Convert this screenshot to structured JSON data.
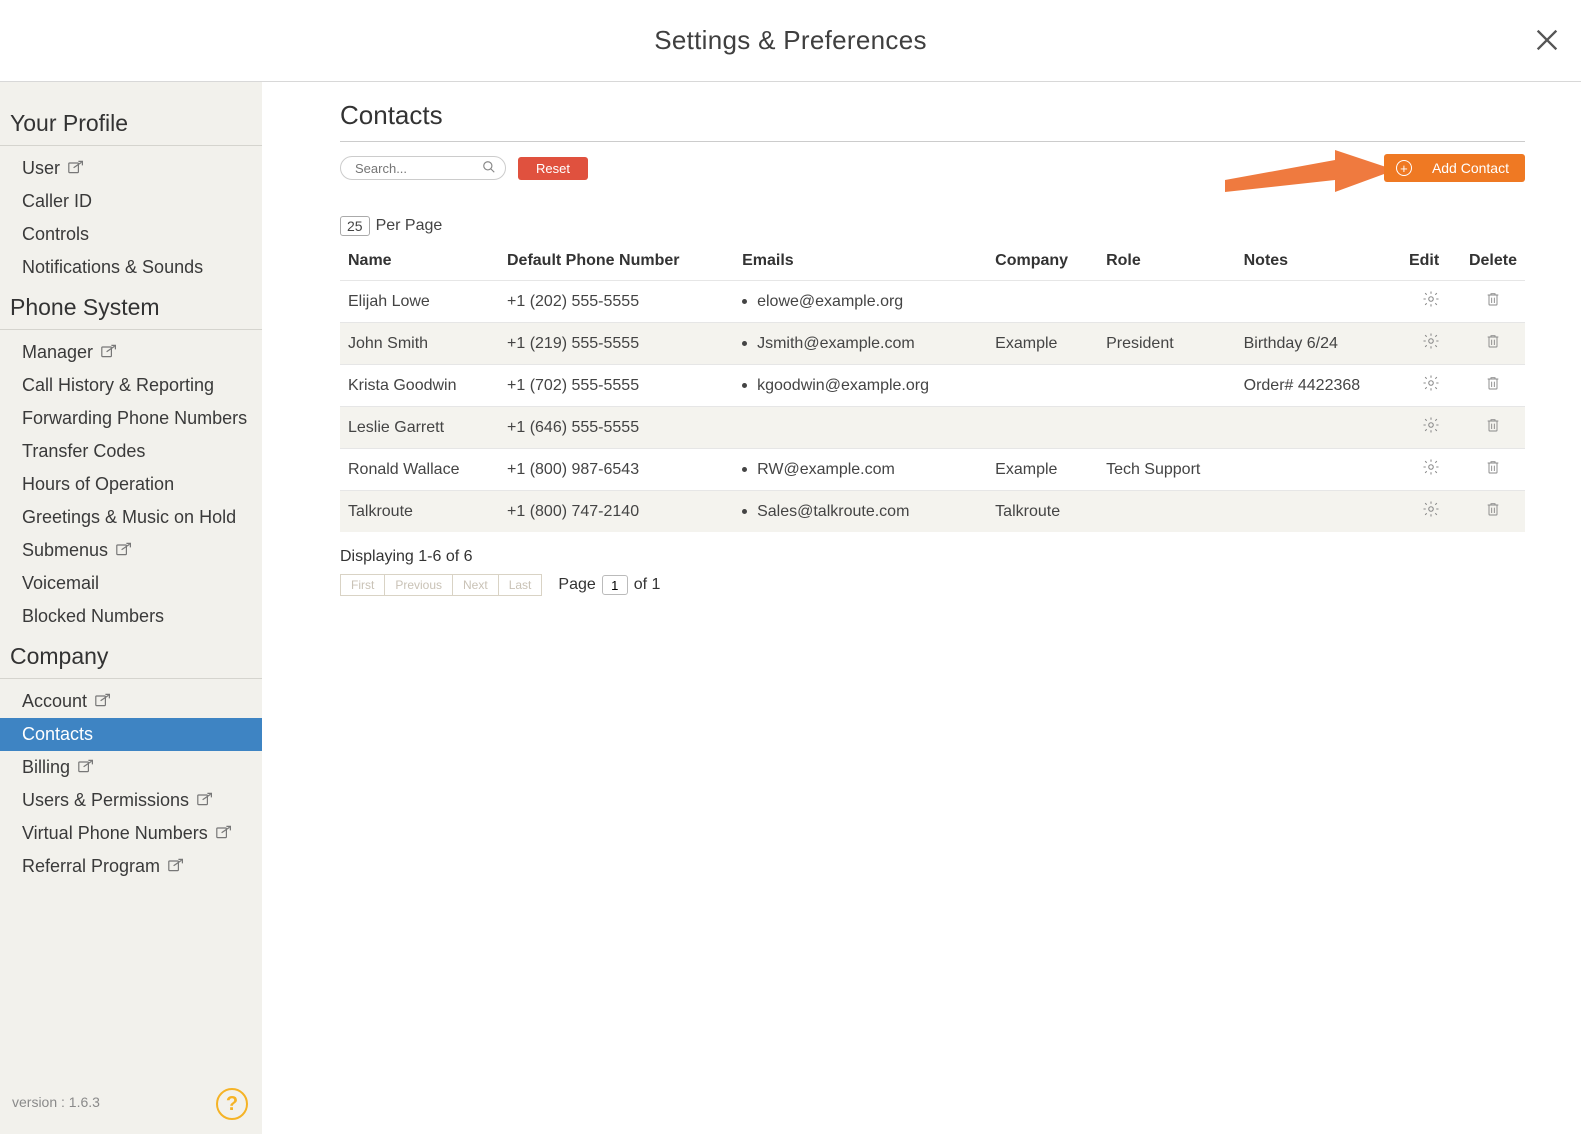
{
  "header": {
    "title": "Settings & Preferences"
  },
  "sidebar": {
    "sections": [
      {
        "heading": "Your Profile",
        "items": [
          {
            "label": "User",
            "ext": true
          },
          {
            "label": "Caller ID"
          },
          {
            "label": "Controls"
          },
          {
            "label": "Notifications & Sounds"
          }
        ]
      },
      {
        "heading": "Phone System",
        "items": [
          {
            "label": "Manager",
            "ext": true
          },
          {
            "label": "Call History & Reporting"
          },
          {
            "label": "Forwarding Phone Numbers"
          },
          {
            "label": "Transfer Codes"
          },
          {
            "label": "Hours of Operation"
          },
          {
            "label": "Greetings & Music on Hold"
          },
          {
            "label": "Submenus",
            "ext": true
          },
          {
            "label": "Voicemail"
          },
          {
            "label": "Blocked Numbers"
          }
        ]
      },
      {
        "heading": "Company",
        "items": [
          {
            "label": "Account",
            "ext": true
          },
          {
            "label": "Contacts",
            "active": true
          },
          {
            "label": "Billing",
            "ext": true
          },
          {
            "label": "Users & Permissions",
            "ext": true
          },
          {
            "label": "Virtual Phone Numbers",
            "ext": true
          },
          {
            "label": "Referral Program",
            "ext": true
          }
        ]
      }
    ],
    "version": "version : 1.6.3"
  },
  "page": {
    "title": "Contacts",
    "search_placeholder": "Search...",
    "reset_label": "Reset",
    "add_label": "Add Contact",
    "per_page_value": "25",
    "per_page_label": "Per Page",
    "columns": {
      "name": "Name",
      "phone": "Default Phone Number",
      "emails": "Emails",
      "company": "Company",
      "role": "Role",
      "notes": "Notes",
      "edit": "Edit",
      "delete": "Delete"
    },
    "rows": [
      {
        "name": "Elijah Lowe",
        "phone": "+1 (202) 555-5555",
        "email": "elowe@example.org",
        "company": "",
        "role": "",
        "notes": ""
      },
      {
        "name": "John Smith",
        "phone": "+1 (219) 555-5555",
        "email": "Jsmith@example.com",
        "company": "Example",
        "role": "President",
        "notes": "Birthday 6/24"
      },
      {
        "name": "Krista Goodwin",
        "phone": "+1 (702) 555-5555",
        "email": "kgoodwin@example.org",
        "company": "",
        "role": "",
        "notes": "Order# 4422368"
      },
      {
        "name": "Leslie Garrett",
        "phone": "+1 (646) 555-5555",
        "email": "",
        "company": "",
        "role": "",
        "notes": ""
      },
      {
        "name": "Ronald Wallace",
        "phone": "+1 (800) 987-6543",
        "email": "RW@example.com",
        "company": "Example",
        "role": "Tech Support",
        "notes": ""
      },
      {
        "name": "Talkroute",
        "phone": "+1 (800) 747-2140",
        "email": "Sales@talkroute.com",
        "company": "Talkroute",
        "role": "",
        "notes": ""
      }
    ],
    "displaying": "Displaying 1-6 of 6",
    "pager": {
      "first": "First",
      "prev": "Previous",
      "next": "Next",
      "last": "Last",
      "page_label": "Page",
      "page_value": "1",
      "of_label": "of 1"
    }
  }
}
